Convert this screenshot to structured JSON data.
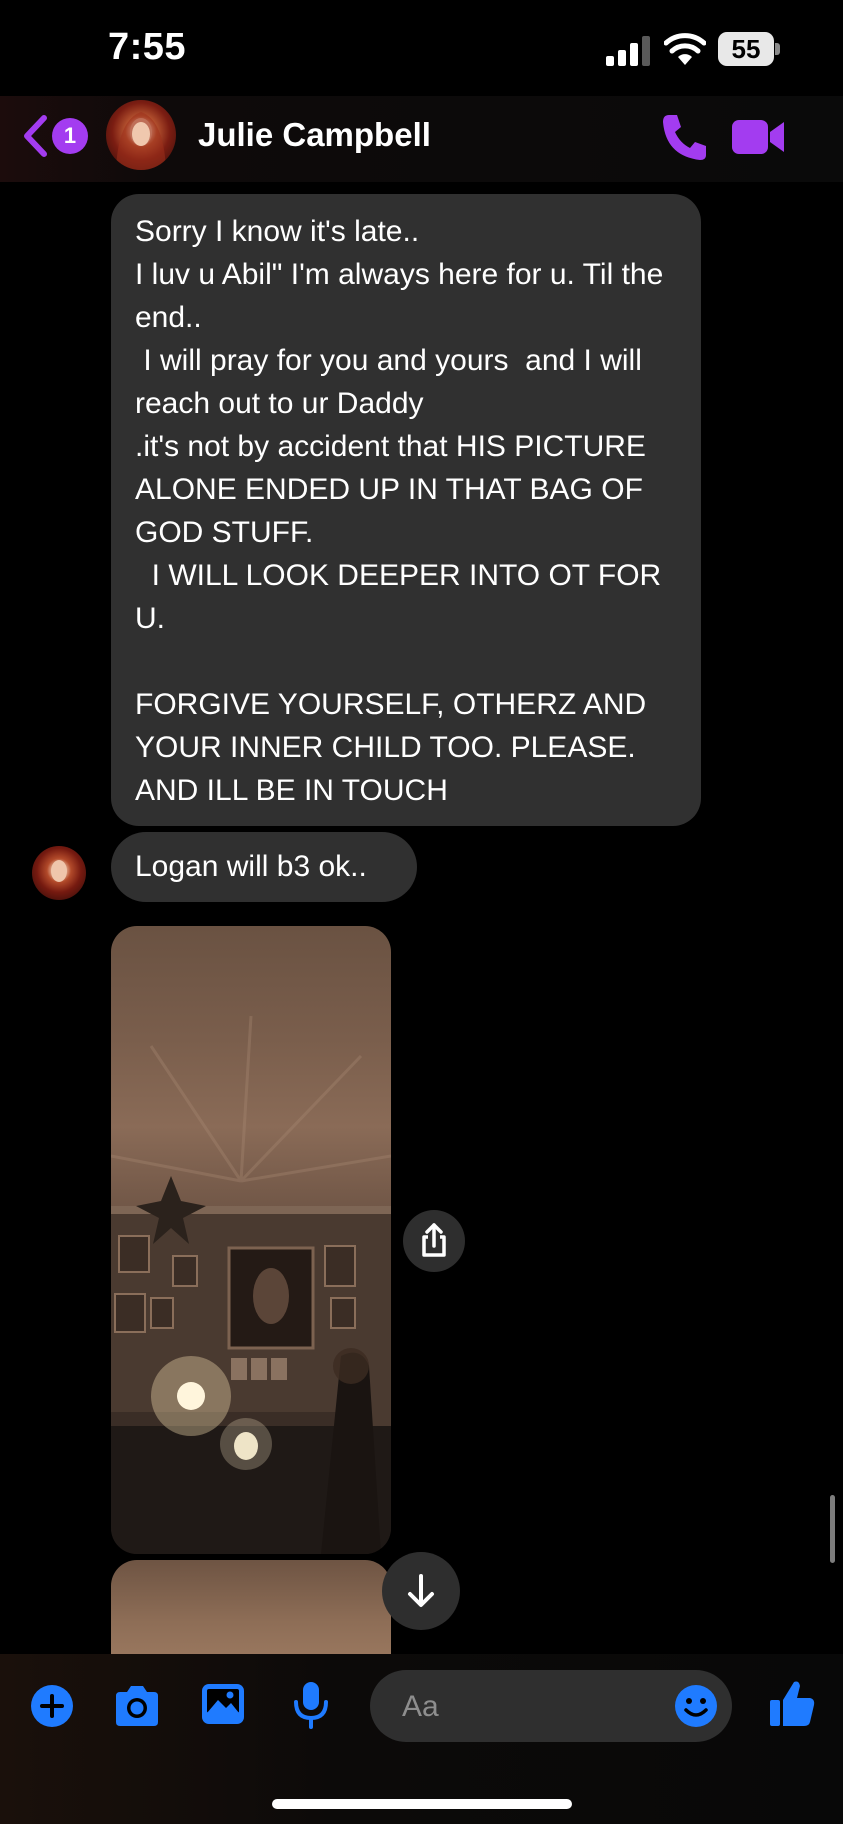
{
  "status_bar": {
    "time": "7:55",
    "battery": "55"
  },
  "header": {
    "unread_count": "1",
    "contact_name": "Julie Campbell",
    "icons": [
      "back-chevron-icon",
      "phone-icon",
      "video-camera-icon"
    ],
    "accent_color": "#a33cf0"
  },
  "messages": [
    {
      "sender": "Julie Campbell",
      "text": "Sorry I know it's late..\nI luv u Abil\" I'm always here for u. Til the end..\n I will pray for you and yours  and I will reach out to ur Daddy\n.it's not by accident that HIS PICTURE ALONE ENDED UP IN THAT BAG OF GOD STUFF.\n  I WILL LOOK DEEPER INTO OT FOR U.\n\nFORGIVE YOURSELF, OTHERZ AND YOUR INNER CHILD TOO. PLEASE. AND ILL BE IN TOUCH"
    },
    {
      "sender": "Julie Campbell",
      "text": "Logan will b3 ok.."
    }
  ],
  "composer": {
    "placeholder": "Aa",
    "icons": [
      "plus-icon",
      "camera-icon",
      "gallery-icon",
      "microphone-icon",
      "emoji-icon",
      "thumbs-up-icon"
    ],
    "icon_color": "#1f7bff"
  }
}
